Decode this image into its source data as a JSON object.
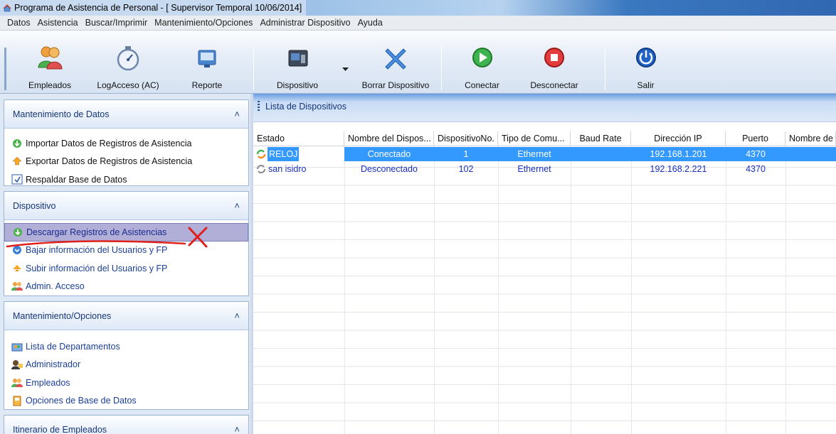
{
  "window": {
    "title": "Programa de Asistencia de Personal - [ Supervisor Temporal 10/06/2014]"
  },
  "menu": [
    "Datos",
    "Asistencia",
    "Buscar/Imprimir",
    "Mantenimiento/Opciones",
    "Administrar Dispositivo",
    "Ayuda"
  ],
  "toolbar": {
    "empleados": "Empleados",
    "logacceso": "LogAcceso (AC)",
    "reporte": "Reporte",
    "dispositivo": "Dispositivo",
    "borrar": "Borrar Dispositivo",
    "conectar": "Conectar",
    "desconectar": "Desconectar",
    "salir": "Salir"
  },
  "sidebar": {
    "groups": [
      {
        "title": "Mantenimiento de Datos",
        "items": [
          "Importar Datos de Registros de Asistencia",
          "Exportar Datos de Registros de Asistencia",
          "Respaldar Base de Datos"
        ]
      },
      {
        "title": "Dispositivo",
        "items": [
          "Descargar Registros de Asistencias",
          "Bajar información del Usuarios y FP",
          "Subir información del Usuarios y FP",
          "Admin. Acceso"
        ]
      },
      {
        "title": "Mantenimiento/Opciones",
        "items": [
          "Lista de Departamentos",
          "Administrador",
          "Empleados",
          "Opciones de Base de Datos"
        ]
      },
      {
        "title": "Itinerario de Empleados",
        "items": []
      }
    ]
  },
  "main": {
    "header": "Lista de Dispositivos",
    "columns": [
      "Estado",
      "Nombre del Dispos...",
      "DispositivoNo.",
      "Tipo de Comu...",
      "Baud Rate",
      "Dirección IP",
      "Puerto",
      "Nombre de"
    ],
    "rows": [
      [
        "RELOJ",
        "Conectado",
        "1",
        "Ethernet",
        "",
        "192.168.1.201",
        "4370",
        ""
      ],
      [
        "san isidro",
        "Desconectado",
        "102",
        "Ethernet",
        "",
        "192.168.2.221",
        "4370",
        ""
      ]
    ]
  },
  "colors": {
    "selection": "#3399ff",
    "annotation": "#e0201c",
    "link_text": "#1a2fc0"
  }
}
